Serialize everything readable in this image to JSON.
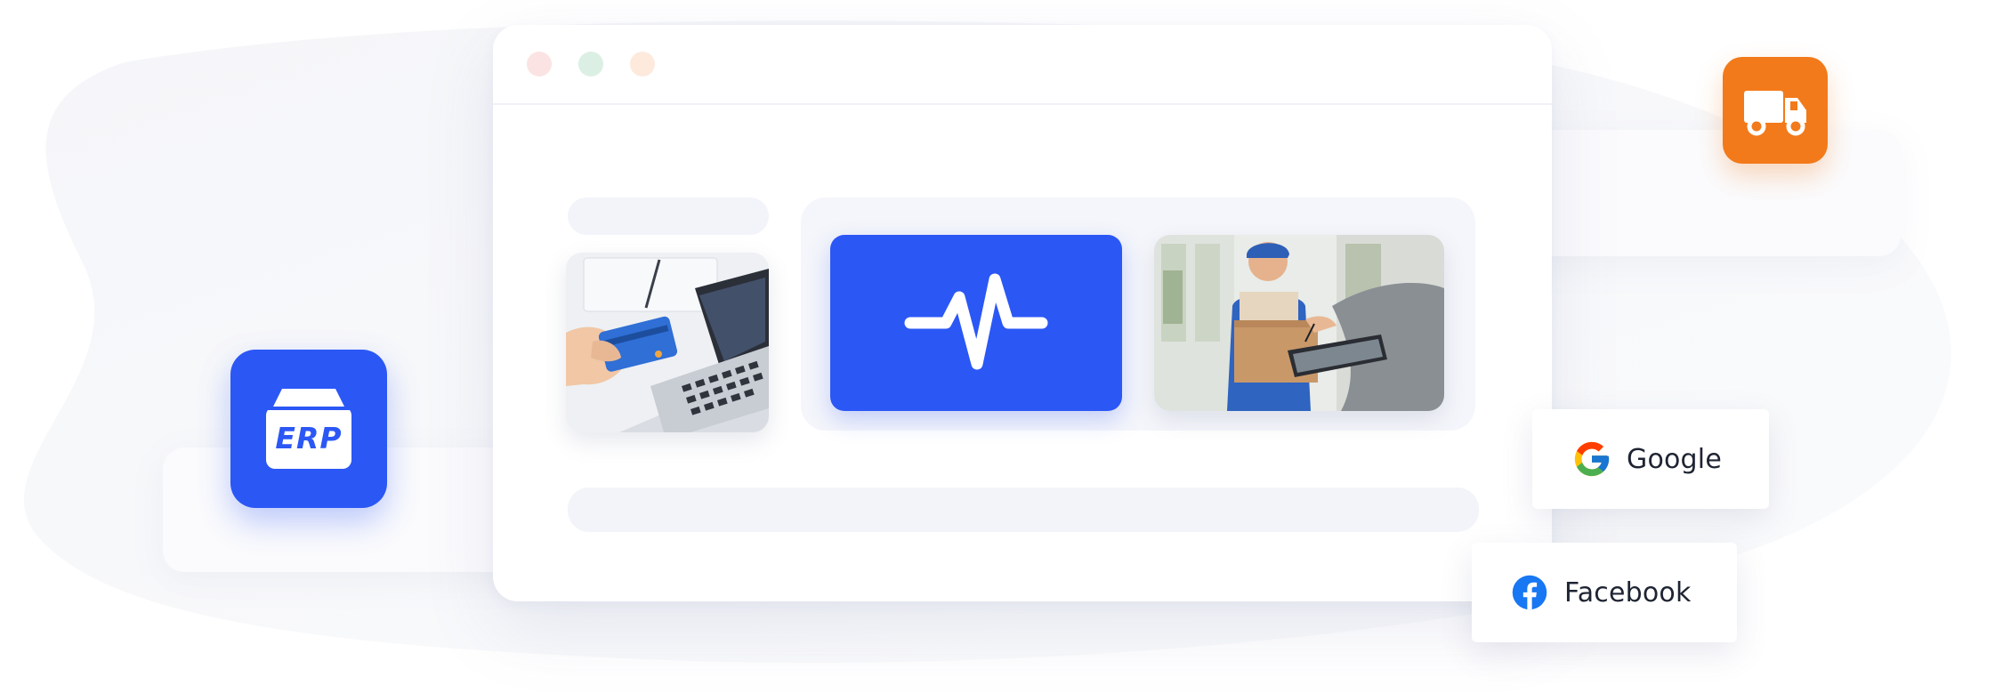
{
  "window": {
    "traffic_lights": [
      "close-dot",
      "minimize-dot",
      "zoom-dot"
    ],
    "colors": {
      "close": "#fbe3e4",
      "minimize": "#dcefe5",
      "zoom": "#fdeadd"
    }
  },
  "tiles": {
    "payment_photo": "card-payment-photo",
    "activity_icon": "heartbeat-icon",
    "delivery_photo": "courier-delivery-photo"
  },
  "badges": {
    "erp": {
      "icon": "erp-box-icon",
      "label": "ERP",
      "color": "#2b57f5"
    },
    "shipping": {
      "icon": "delivery-truck-icon",
      "color": "#f27a1a"
    }
  },
  "integrations": {
    "google": {
      "icon": "google-logo-icon",
      "label": "Google"
    },
    "facebook": {
      "icon": "facebook-logo-icon",
      "label": "Facebook",
      "color": "#1877f2"
    }
  }
}
